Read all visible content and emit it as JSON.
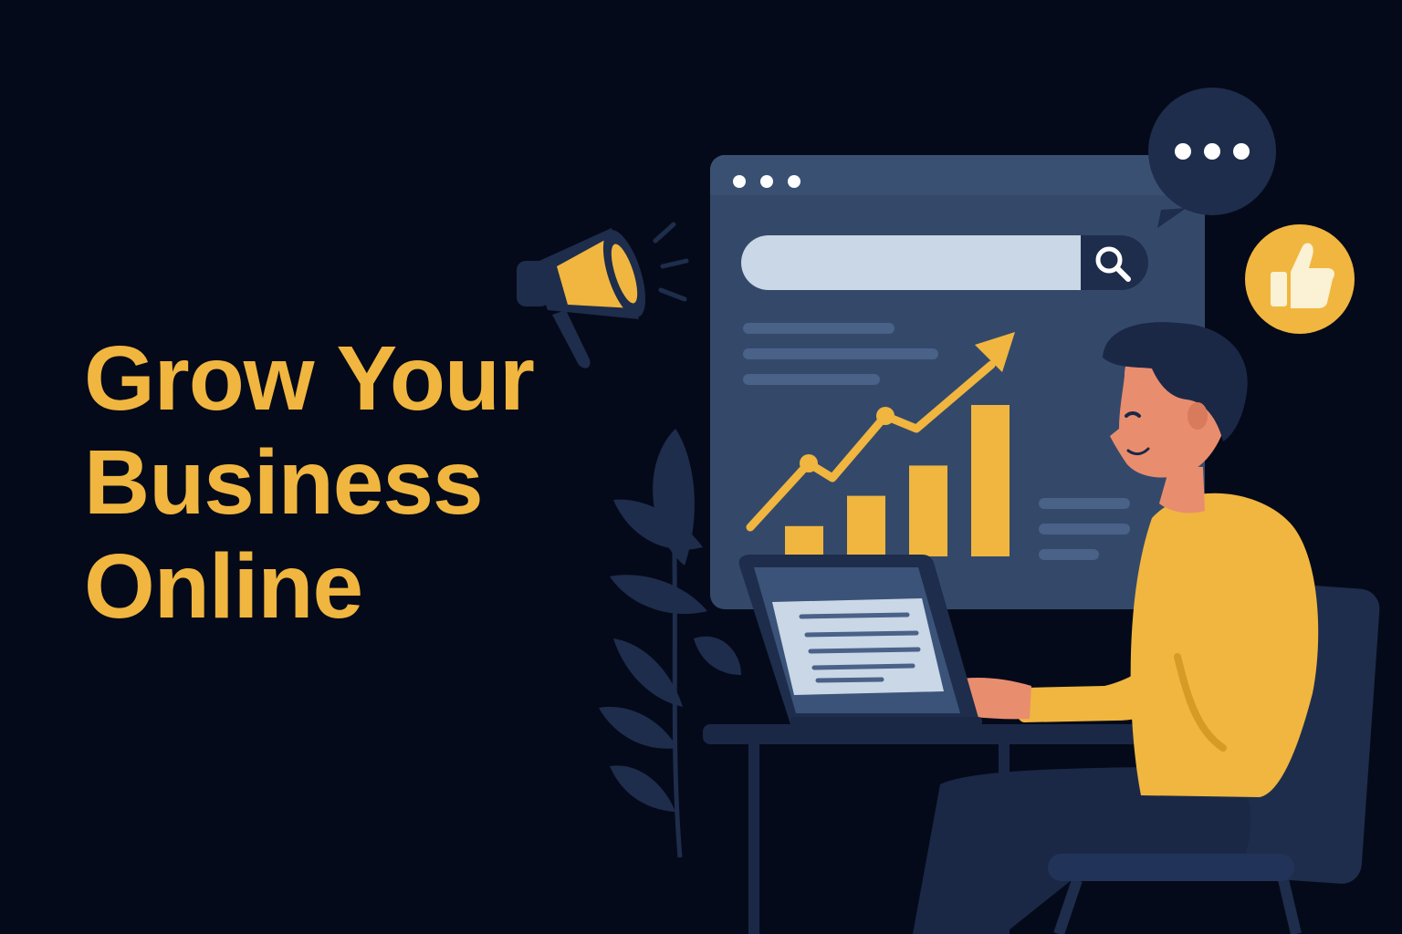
{
  "headline": {
    "lines": [
      "Grow Your",
      "Business",
      "Online"
    ]
  },
  "colors": {
    "background": "#050a1a",
    "accent": "#f0b63f",
    "panel": "#34496a",
    "navy": "#1a2846",
    "light": "#c9d7e6"
  },
  "illustration": {
    "icons": [
      "megaphone-icon",
      "search-icon",
      "chat-bubble-icon",
      "thumbs-up-icon",
      "growth-arrow-icon",
      "plant-icon",
      "laptop-icon",
      "chair-icon"
    ],
    "chart": {
      "type": "bar",
      "values": [
        1,
        2,
        3,
        5
      ]
    }
  }
}
